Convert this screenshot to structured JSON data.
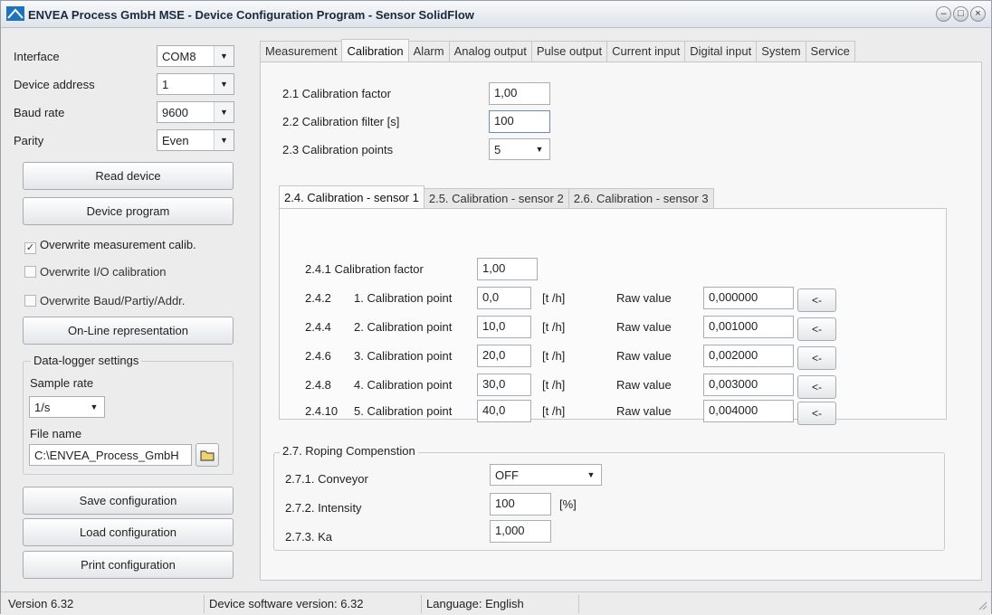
{
  "window": {
    "title": "ENVEA Process GmbH MSE - Device Configuration Program - Sensor SolidFlow",
    "buttons": [
      "minimize",
      "maximize",
      "close"
    ]
  },
  "left": {
    "interface_label": "Interface",
    "interface_value": "COM8",
    "address_label": "Device address",
    "address_value": "1",
    "baud_label": "Baud rate",
    "baud_value": "9600",
    "parity_label": "Parity",
    "parity_value": "Even",
    "read_device": "Read device",
    "device_program": "Device program",
    "overwrite_meas": "Overwrite measurement calib.",
    "overwrite_meas_checked": true,
    "overwrite_io": "Overwrite I/O calibration",
    "overwrite_io_checked": false,
    "overwrite_baud": "Overwrite Baud/Partiy/Addr.",
    "overwrite_baud_checked": false,
    "online": "On-Line representation",
    "logger_title": "Data-logger settings",
    "sample_rate_label": "Sample rate",
    "sample_rate_value": "1/s",
    "file_name_label": "File name",
    "file_name_value": "C:\\ENVEA_Process_GmbH",
    "save_config": "Save configuration",
    "load_config": "Load configuration",
    "print_config": "Print configuration"
  },
  "tabs": [
    "Measurement",
    "Calibration",
    "Alarm",
    "Analog output",
    "Pulse output",
    "Current input",
    "Digital input",
    "System",
    "Service"
  ],
  "active_tab": "Calibration",
  "calibration": {
    "factor_label": "2.1 Calibration factor",
    "factor_value": "1,00",
    "filter_label": "2.2 Calibration filter [s]",
    "filter_value": "100",
    "points_label": "2.3 Calibration points",
    "points_value": "5",
    "subtabs": [
      "2.4. Calibration - sensor 1",
      "2.5. Calibration - sensor 2",
      "2.6. Calibration - sensor 3"
    ],
    "sensor_factor_label": "2.4.1 Calibration factor",
    "sensor_factor_value": "1,00",
    "unit": "[t  /h]",
    "raw_label": "Raw value",
    "arrow_btn": "<-",
    "points": [
      {
        "num": "2.4.2",
        "name": "1. Calibration point",
        "value": "0,0",
        "raw": "0,000000"
      },
      {
        "num": "2.4.4",
        "name": "2. Calibration point",
        "value": "10,0",
        "raw": "0,001000"
      },
      {
        "num": "2.4.6",
        "name": "3. Calibration point",
        "value": "20,0",
        "raw": "0,002000"
      },
      {
        "num": "2.4.8",
        "name": "4. Calibration point",
        "value": "30,0",
        "raw": "0,003000"
      },
      {
        "num": "2.4.10",
        "name": "5. Calibration point",
        "value": "40,0",
        "raw": "0,004000"
      }
    ],
    "roping": {
      "title": "2.7. Roping Compenstion",
      "conveyor_label": "2.7.1. Conveyor",
      "conveyor_value": "OFF",
      "intensity_label": "2.7.2. Intensity",
      "intensity_value": "100",
      "intensity_unit": "[%]",
      "ka_label": "2.7.3. Ka",
      "ka_value": "1,000"
    }
  },
  "status": {
    "version": "Version 6.32",
    "device_sw": "Device software version: 6.32",
    "language": "Language: English"
  }
}
